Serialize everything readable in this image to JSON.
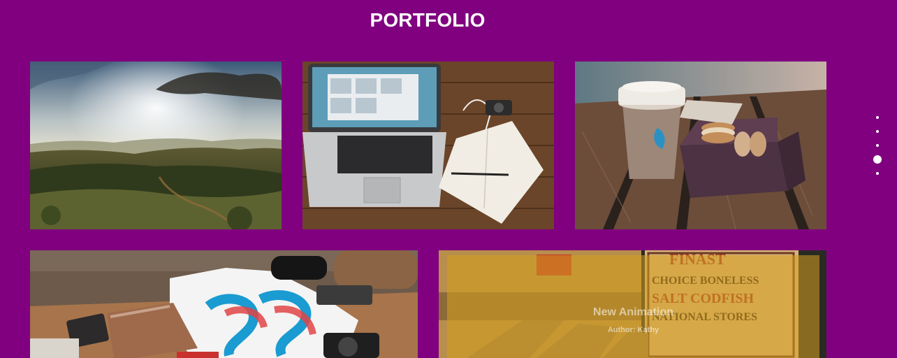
{
  "section": {
    "title": "PORTFOLIO"
  },
  "colors": {
    "background": "#800080",
    "text": "#ffffff",
    "overlay": "#d6a01e"
  },
  "portfolio": {
    "items": [
      {
        "subject": "mountain landscape"
      },
      {
        "subject": "laptop and notebook on desk"
      },
      {
        "subject": "coffee cup and macarons"
      },
      {
        "subject": "t-shirt and desk items"
      },
      {
        "subject": "vintage codfish crate",
        "overlay_title": "New Animation",
        "overlay_author": "Author: Kathy"
      }
    ]
  },
  "pagination": {
    "count": 5,
    "active_index": 3
  }
}
